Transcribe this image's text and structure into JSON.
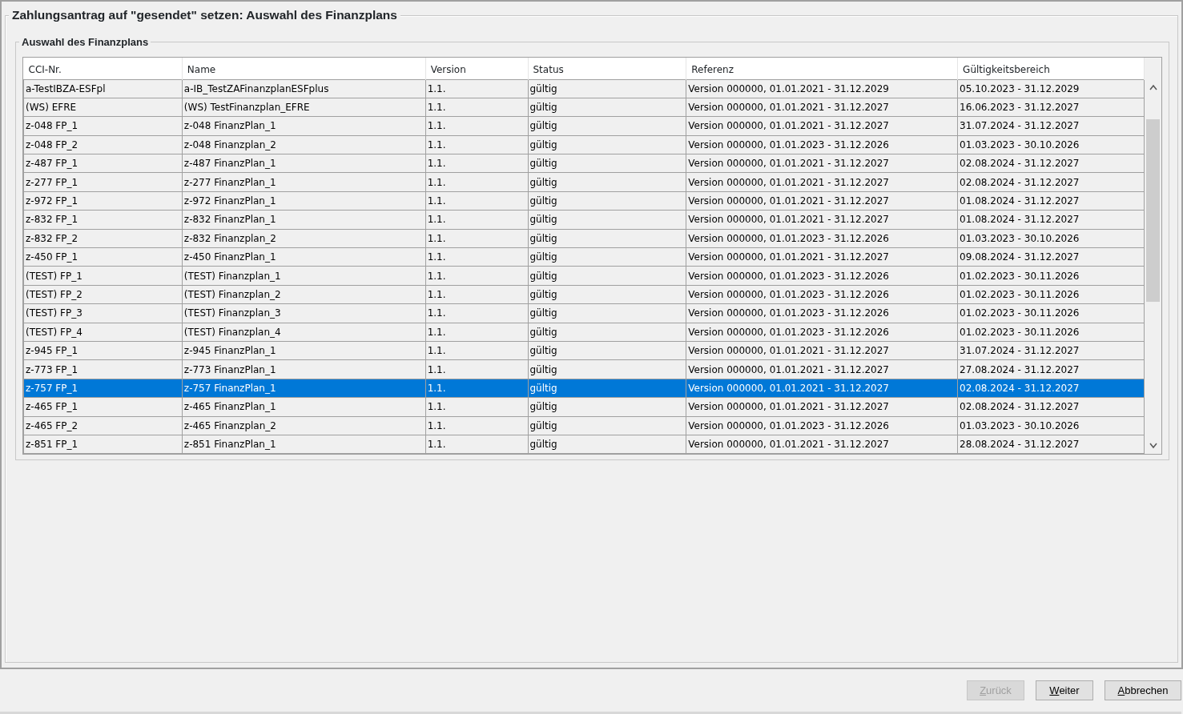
{
  "dialog": {
    "title": "Zahlungsantrag auf \"gesendet\" setzen: Auswahl des Finanzplans"
  },
  "group": {
    "title": "Auswahl des Finanzplans"
  },
  "table": {
    "columns": [
      "CCI-Nr.",
      "Name",
      "Version",
      "Status",
      "Referenz",
      "Gültigkeitsbereich"
    ],
    "rows": [
      {
        "cells": [
          "a-TestIBZA-ESFpl",
          "a-IB_TestZAFinanzplanESFplus",
          "1.1.",
          "gültig",
          "Version 000000,  01.01.2021 - 31.12.2029",
          "05.10.2023 - 31.12.2029"
        ],
        "selected": false
      },
      {
        "cells": [
          "(WS) EFRE",
          "(WS) TestFinanzplan_EFRE",
          "1.1.",
          "gültig",
          "Version 000000,  01.01.2021 - 31.12.2027",
          "16.06.2023 - 31.12.2027"
        ],
        "selected": false
      },
      {
        "cells": [
          "z-048 FP_1",
          "z-048 FinanzPlan_1",
          "1.1.",
          "gültig",
          "Version 000000,  01.01.2021 - 31.12.2027",
          "31.07.2024 - 31.12.2027"
        ],
        "selected": false
      },
      {
        "cells": [
          "z-048 FP_2",
          "z-048 Finanzplan_2",
          "1.1.",
          "gültig",
          "Version 000000,  01.01.2023 - 31.12.2026",
          "01.03.2023 - 30.10.2026"
        ],
        "selected": false
      },
      {
        "cells": [
          "z-487 FP_1",
          "z-487 FinanzPlan_1",
          "1.1.",
          "gültig",
          "Version 000000,  01.01.2021 - 31.12.2027",
          "02.08.2024 - 31.12.2027"
        ],
        "selected": false
      },
      {
        "cells": [
          "z-277 FP_1",
          "z-277 FinanzPlan_1",
          "1.1.",
          "gültig",
          "Version 000000,  01.01.2021 - 31.12.2027",
          "02.08.2024 - 31.12.2027"
        ],
        "selected": false
      },
      {
        "cells": [
          "z-972 FP_1",
          "z-972 FinanzPlan_1",
          "1.1.",
          "gültig",
          "Version 000000,  01.01.2021 - 31.12.2027",
          "01.08.2024 - 31.12.2027"
        ],
        "selected": false
      },
      {
        "cells": [
          "z-832 FP_1",
          "z-832 FinanzPlan_1",
          "1.1.",
          "gültig",
          "Version 000000,  01.01.2021 - 31.12.2027",
          "01.08.2024 - 31.12.2027"
        ],
        "selected": false
      },
      {
        "cells": [
          "z-832 FP_2",
          "z-832 Finanzplan_2",
          "1.1.",
          "gültig",
          "Version 000000,  01.01.2023 - 31.12.2026",
          "01.03.2023 - 30.10.2026"
        ],
        "selected": false
      },
      {
        "cells": [
          "z-450 FP_1",
          "z-450 FinanzPlan_1",
          "1.1.",
          "gültig",
          "Version 000000,  01.01.2021 - 31.12.2027",
          "09.08.2024 - 31.12.2027"
        ],
        "selected": false
      },
      {
        "cells": [
          "(TEST) FP_1",
          "(TEST) Finanzplan_1",
          "1.1.",
          "gültig",
          "Version 000000,  01.01.2023 - 31.12.2026",
          "01.02.2023 - 30.11.2026"
        ],
        "selected": false
      },
      {
        "cells": [
          "(TEST) FP_2",
          "(TEST) Finanzplan_2",
          "1.1.",
          "gültig",
          "Version 000000,  01.01.2023 - 31.12.2026",
          "01.02.2023 - 30.11.2026"
        ],
        "selected": false
      },
      {
        "cells": [
          "(TEST) FP_3",
          "(TEST) Finanzplan_3",
          "1.1.",
          "gültig",
          "Version 000000,  01.01.2023 - 31.12.2026",
          "01.02.2023 - 30.11.2026"
        ],
        "selected": false
      },
      {
        "cells": [
          "(TEST) FP_4",
          "(TEST) Finanzplan_4",
          "1.1.",
          "gültig",
          "Version 000000,  01.01.2023 - 31.12.2026",
          "01.02.2023 - 30.11.2026"
        ],
        "selected": false
      },
      {
        "cells": [
          "z-945 FP_1",
          "z-945 FinanzPlan_1",
          "1.1.",
          "gültig",
          "Version 000000,  01.01.2021 - 31.12.2027",
          "31.07.2024 - 31.12.2027"
        ],
        "selected": false
      },
      {
        "cells": [
          "z-773 FP_1",
          "z-773 FinanzPlan_1",
          "1.1.",
          "gültig",
          "Version 000000,  01.01.2021 - 31.12.2027",
          "27.08.2024 - 31.12.2027"
        ],
        "selected": false
      },
      {
        "cells": [
          "z-757 FP_1",
          "z-757 FinanzPlan_1",
          "1.1.",
          "gültig",
          "Version 000000,  01.01.2021 - 31.12.2027",
          "02.08.2024 - 31.12.2027"
        ],
        "selected": true
      },
      {
        "cells": [
          "z-465 FP_1",
          "z-465 FinanzPlan_1",
          "1.1.",
          "gültig",
          "Version 000000,  01.01.2021 - 31.12.2027",
          "02.08.2024 - 31.12.2027"
        ],
        "selected": false
      },
      {
        "cells": [
          "z-465 FP_2",
          "z-465 Finanzplan_2",
          "1.1.",
          "gültig",
          "Version 000000,  01.01.2023 - 31.12.2026",
          "01.03.2023 - 30.10.2026"
        ],
        "selected": false
      },
      {
        "cells": [
          "z-851 FP_1",
          "z-851 FinanzPlan_1",
          "1.1.",
          "gültig",
          "Version 000000,  01.01.2021 - 31.12.2027",
          "28.08.2024 - 31.12.2027"
        ],
        "selected": false
      }
    ]
  },
  "buttons": [
    {
      "label": "Zurück",
      "disabled": true,
      "mnemonic": true
    },
    {
      "label": "Weiter",
      "disabled": false,
      "mnemonic": true
    },
    {
      "label": "Abbrechen",
      "disabled": false,
      "mnemonic": true
    }
  ]
}
